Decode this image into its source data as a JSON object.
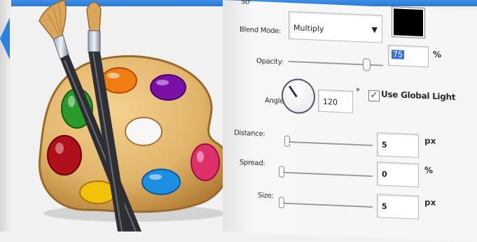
{
  "blend_section": {
    "blend_mode_label": "Blend Mode:",
    "blend_mode_value": "Multiply",
    "shadow_color": "#000000"
  },
  "opacity": {
    "label": "Opacity:",
    "value": "75",
    "unit": "%",
    "slider_fraction": 0.82
  },
  "angle": {
    "label": "Angle:",
    "value": "120",
    "unit": "°",
    "use_global_light_label": "Use Global Light",
    "use_global_light_checked": true
  },
  "distance": {
    "label": "Distance:",
    "value": "5",
    "unit": "px"
  },
  "spread": {
    "label": "Spread:",
    "value": "0",
    "unit": "%"
  },
  "size": {
    "label": "Size:",
    "value": "5",
    "unit": "px"
  },
  "icons": [
    "paint-palette-icon",
    "paintbrush-icon",
    "back-arrow-icon",
    "dropdown-arrow-icon",
    "angle-dial-icon",
    "checkmark-icon"
  ],
  "colors": {
    "accent_blue": "#2d7fe0",
    "selection_blue": "#3d6fd8",
    "palette_wood": "#e1b46a",
    "paint_orange": "#f17d12",
    "paint_purple": "#7a10a8",
    "paint_green": "#2a9a2a",
    "paint_red": "#b0101a",
    "paint_yellow": "#f2c10a",
    "paint_blue": "#1e8ee0",
    "paint_pink": "#e0306c"
  }
}
